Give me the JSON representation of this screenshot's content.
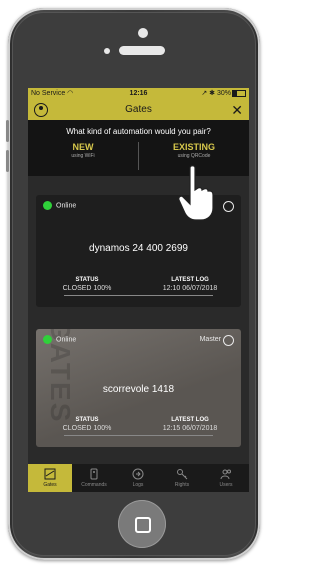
{
  "statusbar": {
    "carrier": "No Service",
    "time": "12:16",
    "battery": "30%"
  },
  "header": {
    "title": "Gates"
  },
  "pair": {
    "question": "What kind of automation would you pair?",
    "new_label": "NEW",
    "new_sub": "using WiFi",
    "existing_label": "EXISTING",
    "existing_sub": "using QRCode"
  },
  "gates": [
    {
      "online": "Online",
      "name": "dynamos 24 400 2699",
      "status_label": "STATUS",
      "status_value": "CLOSED 100%",
      "log_label": "LATEST LOG",
      "log_value": "12:10 06/07/2018"
    },
    {
      "online": "Online",
      "role": "Master",
      "name": "scorrevole 1418",
      "status_label": "STATUS",
      "status_value": "CLOSED 100%",
      "log_label": "LATEST LOG",
      "log_value": "12:15 06/07/2018"
    }
  ],
  "tabs": [
    {
      "label": "Gates",
      "icon": "gate-icon",
      "active": true
    },
    {
      "label": "Commands",
      "icon": "remote-icon"
    },
    {
      "label": "Logs",
      "icon": "logs-icon"
    },
    {
      "label": "Rights",
      "icon": "key-icon"
    },
    {
      "label": "Users",
      "icon": "users-icon"
    }
  ],
  "colors": {
    "accent": "#c5b93a",
    "online": "#2fd13a",
    "highlight": "#d7c84c"
  }
}
